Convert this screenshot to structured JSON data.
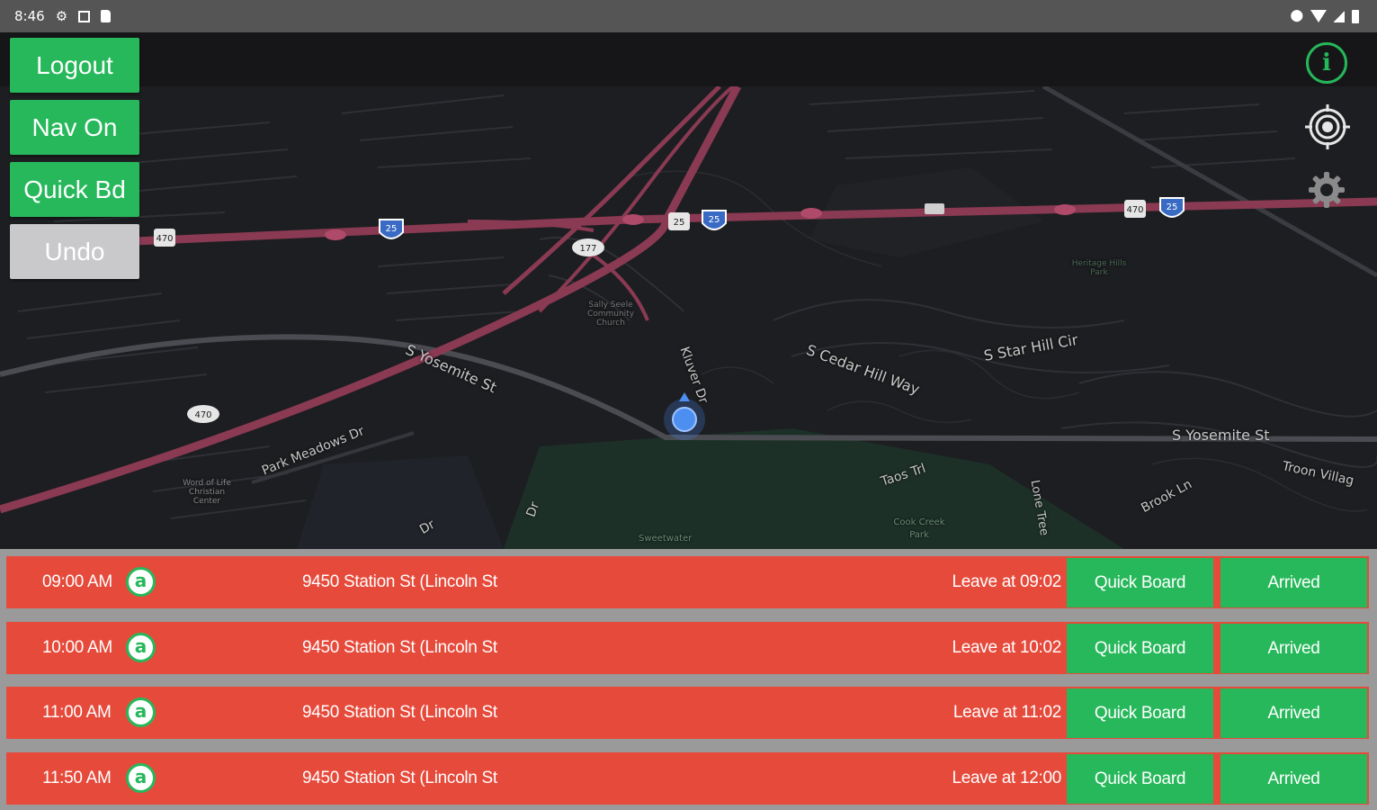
{
  "status_bar": {
    "time": "8:46",
    "left_icons": [
      "settings-icon",
      "square-icon",
      "clipboard-icon"
    ],
    "right_icons": [
      "location-icon",
      "wifi-icon",
      "signal-icon",
      "battery-icon"
    ]
  },
  "side_buttons": {
    "logout": "Logout",
    "nav": "Nav On",
    "quick_board": "Quick Bd",
    "undo": "Undo"
  },
  "map_controls": {
    "info": "i",
    "icons": [
      "info-icon",
      "locate-icon",
      "settings-icon"
    ]
  },
  "map": {
    "labels": {
      "s_yosemite_1": "S Yosemite St",
      "s_yosemite_2": "S Yosemite St",
      "kluver": "Kluver Dr",
      "cedar_hill": "S Cedar Hill Way",
      "star_hill": "S Star Hill Cir",
      "park_meadows": "Park Meadows Dr",
      "taos": "Taos Trl",
      "lone_tree": "Lone Tree",
      "brook": "Brook Ln",
      "troon": "Troon Villag",
      "word_of_life": "Word of Life Christian Center",
      "cook_creek": "Cook Creek Park",
      "church": "Sally Seele Community Church",
      "heritage": "Heritage Hills Park",
      "sweetwater": "Sweetwater",
      "dr1": "Dr",
      "dr2": "Dr"
    },
    "shields": [
      "470",
      "25",
      "177",
      "25",
      "25",
      "470",
      "25"
    ],
    "colors": {
      "highway": "#8a3a52",
      "road": "#3a3c41",
      "land": "#1d1e21",
      "park": "#1f3a2c"
    }
  },
  "trips": [
    {
      "time": "09:00 AM",
      "badge": "a",
      "address": "9450 Station St (Lincoln St",
      "leave": "Leave at  09:02",
      "quick_board": "Quick Board",
      "arrived": "Arrived"
    },
    {
      "time": "10:00 AM",
      "badge": "a",
      "address": "9450 Station St (Lincoln St",
      "leave": "Leave at  10:02",
      "quick_board": "Quick Board",
      "arrived": "Arrived"
    },
    {
      "time": "11:00 AM",
      "badge": "a",
      "address": "9450 Station St (Lincoln St",
      "leave": "Leave at  11:02",
      "quick_board": "Quick Board",
      "arrived": "Arrived"
    },
    {
      "time": "11:50 AM",
      "badge": "a",
      "address": "9450 Station St (Lincoln St",
      "leave": "Leave at  12:00",
      "quick_board": "Quick Board",
      "arrived": "Arrived"
    }
  ],
  "colors": {
    "accent_green": "#27b85b",
    "row_red": "#e64a3b",
    "undo_grey": "#c9c9cc"
  }
}
